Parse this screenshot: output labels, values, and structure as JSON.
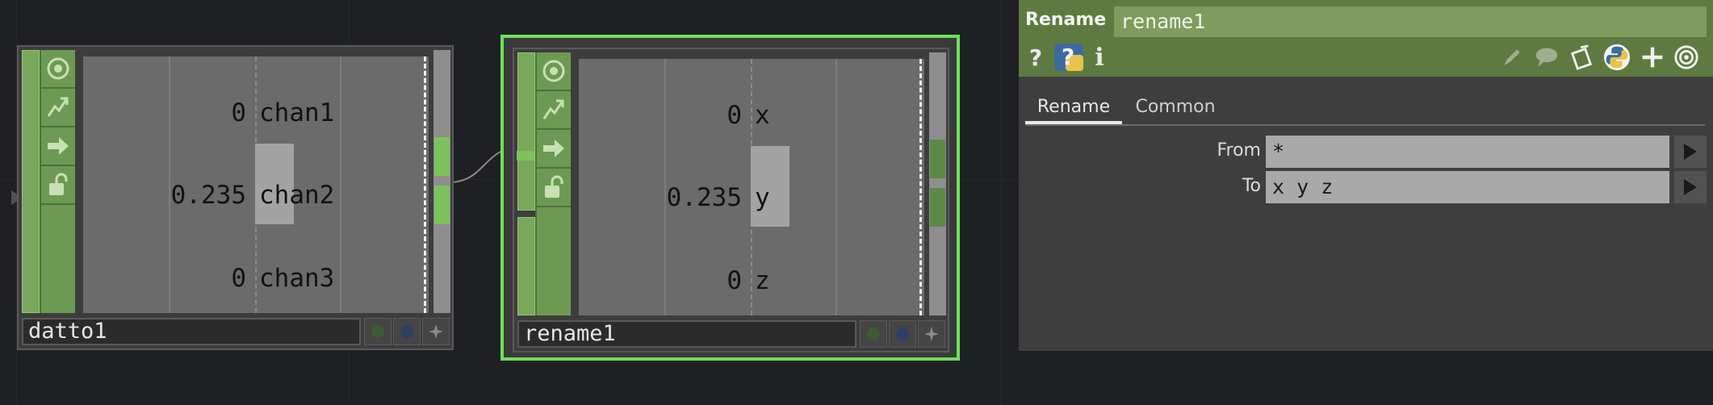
{
  "nodes": [
    {
      "name": "datto1",
      "channels": [
        {
          "value": "0",
          "name": "chan1"
        },
        {
          "value": "0.235",
          "name": "chan2"
        },
        {
          "value": "0",
          "name": "chan3"
        }
      ]
    },
    {
      "name": "rename1",
      "selected": true,
      "channels": [
        {
          "value": "0",
          "name": "x"
        },
        {
          "value": "0.235",
          "name": "y"
        },
        {
          "value": "0",
          "name": "z"
        }
      ]
    }
  ],
  "node_flags": [
    "viewer-flag-icon",
    "cook-flag-icon",
    "bypass-arrow-icon",
    "lock-icon"
  ],
  "panel": {
    "type_label": "Rename",
    "node_name": "rename1",
    "header_icons_left": [
      "help-icon",
      "python-help-icon",
      "info-icon"
    ],
    "header_icons_right": [
      "edit-icon",
      "comment-icon",
      "clipboard-icon",
      "python-icon",
      "add-icon",
      "target-icon"
    ],
    "tabs": [
      {
        "label": "Rename",
        "active": true
      },
      {
        "label": "Common",
        "active": false
      }
    ],
    "params": [
      {
        "label": "From",
        "value": "*"
      },
      {
        "label": "To",
        "value": "x y z"
      }
    ]
  },
  "colors": {
    "background": "#1e2024",
    "node_green": "#78a85a",
    "selected_border": "#6ee05a",
    "panel_header": "#5f7a40",
    "panel_bg": "#3e3e3e"
  }
}
